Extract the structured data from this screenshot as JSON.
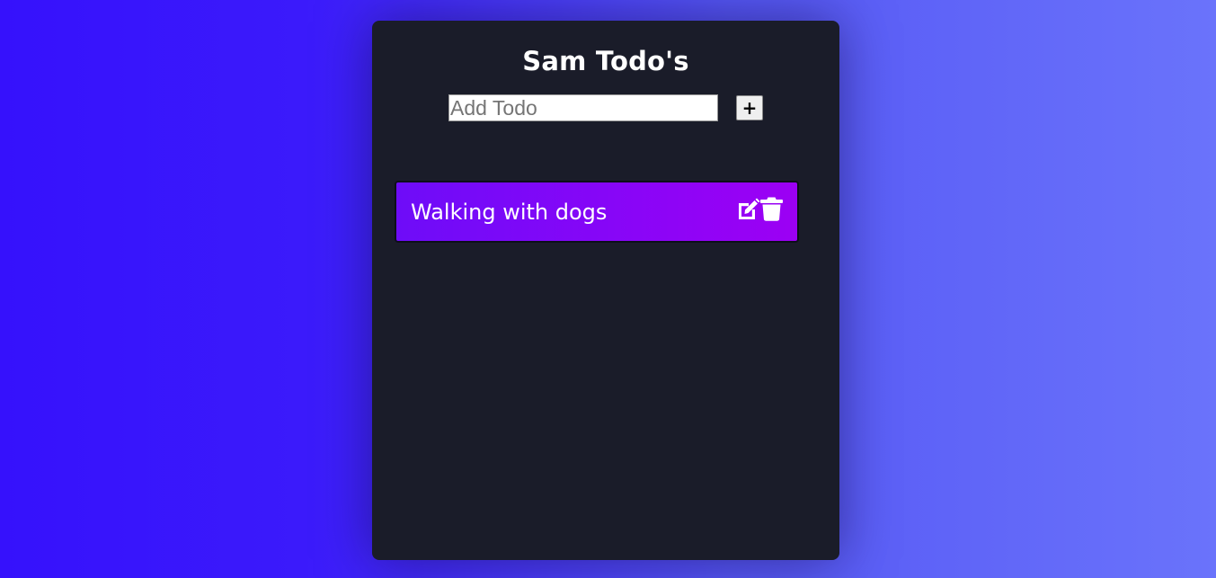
{
  "app": {
    "title": "Sam Todo's"
  },
  "add_form": {
    "placeholder": "Add Todo",
    "value": "",
    "add_button_label": "+"
  },
  "todos": [
    {
      "text": "Walking with dogs",
      "actions": [
        "edit-icon",
        "trash-icon"
      ]
    }
  ],
  "colors": {
    "card_background": "#1a1c29",
    "todo_gradient_start": "#6e0cf8",
    "todo_gradient_end": "#9c00f4",
    "page_gradient_start": "#3611fc",
    "page_gradient_end": "#6a73fb"
  }
}
